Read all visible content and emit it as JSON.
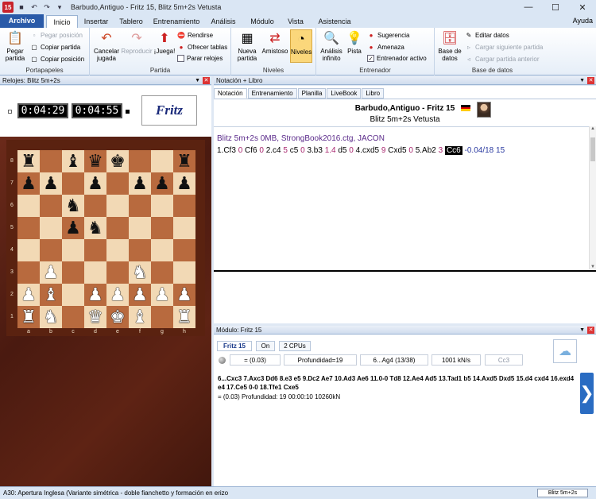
{
  "window": {
    "title": "Barbudo,Antiguo - Fritz 15, Blitz 5m+2s Vetusta",
    "app_icon": "15"
  },
  "ribbon_tabs": [
    "Archivo",
    "Inicio",
    "Insertar",
    "Tablero",
    "Entrenamiento",
    "Análisis",
    "Módulo",
    "Vista",
    "Asistencia"
  ],
  "help_label": "Ayuda",
  "ribbon": {
    "portapapeles": {
      "label": "Portapapeles",
      "pegar": "Pegar partida",
      "pegar_posicion": "Pegar posición",
      "copiar_partida": "Copiar partida",
      "copiar_posicion": "Copiar posición"
    },
    "partida": {
      "label": "Partida",
      "cancelar": "Cancelar jugada",
      "reproducir": "Reproducir",
      "juega": "¡Juega!",
      "rendirse": "Rendirse",
      "ofrecer_tablas": "Ofrecer tablas",
      "parar_relojes": "Parar relojes"
    },
    "niveles": {
      "label": "Niveles",
      "nueva": "Nueva partida",
      "amistoso": "Amistoso",
      "niveles": "Niveles"
    },
    "entrenador": {
      "label": "Entrenador",
      "analisis": "Análisis infinito",
      "pista": "Pista",
      "sugerencia": "Sugerencia",
      "amenaza": "Amenaza",
      "entrenador_activo": "Entrenador activo"
    },
    "base_datos": {
      "label": "Base de datos",
      "base": "Base de datos",
      "editar": "Editar datos",
      "cargar_siguiente": "Cargar siguiente partida",
      "cargar_anterior": "Cargar partida anterior"
    }
  },
  "clocks_pane": {
    "title": "Relojes: Blitz 5m+2s",
    "white_time": "0:04:29",
    "black_time": "0:04:55",
    "logo": "Fritz"
  },
  "board": {
    "ranks": [
      "8",
      "7",
      "6",
      "5",
      "4",
      "3",
      "2",
      "1"
    ],
    "files": [
      "a",
      "b",
      "c",
      "d",
      "e",
      "f",
      "g",
      "h"
    ],
    "rows": [
      [
        "bR",
        "",
        "bB",
        "bQ",
        "bK",
        "",
        "",
        "bR"
      ],
      [
        "bP",
        "bP",
        "",
        "bP",
        "",
        "bP",
        "bP",
        "bP"
      ],
      [
        "",
        "",
        "bN",
        "",
        "",
        "",
        "",
        ""
      ],
      [
        "",
        "",
        "bP",
        "bN",
        "",
        "",
        "",
        ""
      ],
      [
        "",
        "",
        "",
        "",
        "",
        "",
        "",
        ""
      ],
      [
        "",
        "wP",
        "",
        "",
        "",
        "wN",
        "",
        ""
      ],
      [
        "wP",
        "wB",
        "",
        "wP",
        "wP",
        "wP",
        "wP",
        "wP"
      ],
      [
        "wR",
        "wN",
        "",
        "wQ",
        "wK",
        "wB",
        "",
        "wR"
      ]
    ]
  },
  "notation_pane": {
    "title": "Notación + Libro",
    "tabs": [
      "Notación",
      "Entrenamiento",
      "Planilla",
      "LiveBook",
      "Libro"
    ],
    "players": "Barbudo,Antiguo - Fritz 15",
    "event": "Blitz 5m+2s Vetusta",
    "source": "Blitz 5m+2s 0MB, StrongBook2016.ctg, JACON",
    "moves": [
      {
        "m": "1.Cf3",
        "e": "0"
      },
      {
        "m": "Cf6",
        "e": "0"
      },
      {
        "m": "2.c4",
        "e": "5"
      },
      {
        "m": "c5",
        "e": "0"
      },
      {
        "m": "3.b3",
        "e": "1.4"
      },
      {
        "m": "d5",
        "e": "0"
      },
      {
        "m": "4.cxd5",
        "e": "9"
      },
      {
        "m": "Cxd5",
        "e": "0"
      },
      {
        "m": "5.Ab2",
        "e": "3"
      }
    ],
    "current_move": "Cc6",
    "current_eval": "-0.04/18 15"
  },
  "engine_pane": {
    "title": "Módulo: Fritz 15",
    "engine_name": "Fritz 15",
    "on_label": "On",
    "cpus": "2 CPUs",
    "eval": "=  (0.03)",
    "depth": "Profundidad=19",
    "current_move": "6...Ag4 (13/38)",
    "speed": "1001 kN/s",
    "best_move": "Cc3",
    "line": "6...Cxc3 7.Axc3 Dd6 8.e3 e5 9.Dc2 Ae7 10.Ad3 Ae6 11.0-0 Td8 12.Ae4 Ad5 13.Tad1 b5 14.Axd5 Dxd5 15.d4 cxd4 16.exd4 e4 17.Ce5 0-0 18.Tfe1 Cxe5",
    "line_stats": "=  (0.03)    Profundidad: 19    00:00:10   10260kN"
  },
  "status": {
    "opening": "A30: Apertura Inglesa (Variante simétrica - doble fianchetto y formación en erizo",
    "mode": "Blitz 5m+2s"
  },
  "colors": {
    "accent": "#2a5aa8",
    "light_square": "#f2d9b5",
    "dark_square": "#b86a3e",
    "eval_color": "#a8266e"
  }
}
